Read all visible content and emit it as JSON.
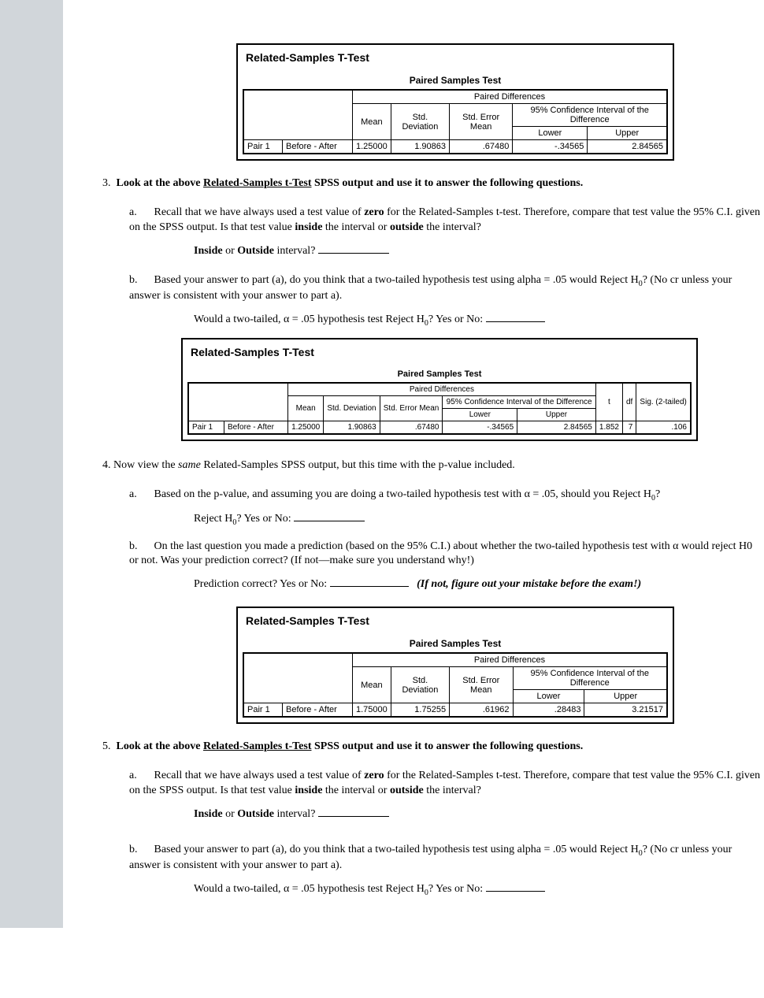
{
  "spss1": {
    "title": "Related-Samples T-Test",
    "caption": "Paired Samples Test",
    "pd": "Paired Differences",
    "ci": "95% Confidence Interval of the Difference",
    "row_label": "Pair 1",
    "row_desc": "Before - After",
    "mean_h": "Mean",
    "std_h": "Std. Deviation",
    "se_h": "Std. Error Mean",
    "lower_h": "Lower",
    "upper_h": "Upper",
    "mean": "1.25000",
    "std": "1.90863",
    "se": ".67480",
    "lower": "-.34565",
    "upper": "2.84565"
  },
  "spss2": {
    "title": "Related-Samples T-Test",
    "caption": "Paired Samples Test",
    "pd": "Paired Differences",
    "ci": "95% Confidence Interval of the Difference",
    "row_label": "Pair 1",
    "row_desc": "Before - After",
    "mean_h": "Mean",
    "std_h": "Std. Deviation",
    "se_h": "Std. Error Mean",
    "lower_h": "Lower",
    "upper_h": "Upper",
    "t_h": "t",
    "df_h": "df",
    "sig_h": "Sig. (2-tailed)",
    "mean": "1.25000",
    "std": "1.90863",
    "se": ".67480",
    "lower": "-.34565",
    "upper": "2.84565",
    "t": "1.852",
    "df": "7",
    "sig": ".106"
  },
  "spss3": {
    "title": "Related-Samples T-Test",
    "caption": "Paired Samples Test",
    "pd": "Paired Differences",
    "ci": "95% Confidence Interval of the Difference",
    "row_label": "Pair 1",
    "row_desc": "Before - After",
    "mean_h": "Mean",
    "std_h": "Std. Deviation",
    "se_h": "Std. Error Mean",
    "lower_h": "Lower",
    "upper_h": "Upper",
    "mean": "1.75000",
    "std": "1.75255",
    "se": ".61962",
    "lower": ".28483",
    "upper": "3.21517"
  },
  "q3": {
    "num": "3.",
    "head_text": "Look at the above ",
    "head_under": "Related-Samples t-Test",
    "head_rest": " SPSS output and use it to answer the following questions.",
    "a_letter": "a.",
    "a_text1": "Recall that we have always used a test value of ",
    "a_zero": "zero",
    "a_text2": " for the Related-Samples t-test.  Therefore, compare that test value the 95% C.I. given on the SPSS output.  Is that test value ",
    "a_inside": "inside",
    "a_text3": " the interval or ",
    "a_outside": "outside",
    "a_text4": " the interval?",
    "a_prompt1": "Inside",
    "a_prompt_or": " or ",
    "a_prompt2": "Outside",
    "a_prompt_rest": " interval? ",
    "b_letter": "b.",
    "b_text": "Based your answer to part (a), do you think that a two-tailed hypothesis test using alpha = .05 would Reject H",
    "b_text2": "? (No cr unless your answer is consistent with your answer to part a).",
    "b_prompt": "Would a two-tailed, α = .05 hypothesis test Reject H",
    "b_prompt2": "?   Yes or No:   "
  },
  "q4": {
    "num": "4.",
    "head1": " Now view the ",
    "head_same": "same",
    "head2": " Related-Samples SPSS output, but this time with the p-value included.",
    "a_letter": "a.",
    "a_text": "Based on the p-value, and assuming you are doing a two-tailed hypothesis test with α = .05, should you Reject H",
    "a_text2": "?",
    "a_prompt": "Reject H",
    "a_prompt2": "?   Yes or No: ",
    "b_letter": "b.",
    "b_text": "On the last question you made a prediction (based on the 95% C.I.) about whether the two-tailed hypothesis test with α would reject H0 or not.  Was your prediction correct?  (If not—make sure you understand why!)",
    "b_prompt": "Prediction correct?  Yes or No: ",
    "b_note": "(If not, figure out your mistake before the exam!)"
  },
  "q5": {
    "num": "5.",
    "head_text": "Look at the above ",
    "head_under": "Related-Samples t-Test",
    "head_rest": " SPSS output and use it to answer the following questions.",
    "a_letter": "a.",
    "a_text1": "Recall that we have always used a test value of ",
    "a_zero": "zero",
    "a_text2": " for the Related-Samples t-test.  Therefore, compare that test value the 95% C.I. given on the SPSS output.  Is that test value ",
    "a_inside": "inside",
    "a_text3": " the interval or ",
    "a_outside": "outside",
    "a_text4": " the interval?",
    "a_prompt1": "Inside",
    "a_prompt_or": " or ",
    "a_prompt2": "Outside",
    "a_prompt_rest": " interval? ",
    "b_letter": "b.",
    "b_text": "Based your answer to part (a), do you think that a two-tailed hypothesis test using alpha = .05 would Reject H",
    "b_text2": "? (No cr unless your answer is consistent with your answer to part a).",
    "b_prompt": "Would a two-tailed, α = .05 hypothesis test Reject H",
    "b_prompt2": "?   Yes or No:   "
  }
}
